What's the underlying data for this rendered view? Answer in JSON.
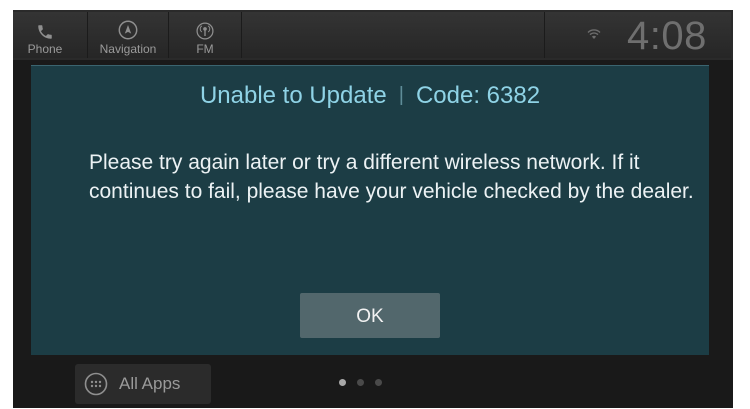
{
  "topbar": {
    "items": [
      {
        "label": "Phone",
        "icon": "phone-icon"
      },
      {
        "label": "Navigation",
        "icon": "compass-icon"
      },
      {
        "label": "FM",
        "icon": "radio-icon"
      }
    ],
    "status_icon": "wifi-icon",
    "clock": "4:08"
  },
  "dialog": {
    "title": "Unable to Update",
    "separator": "|",
    "code": "Code: 6382",
    "message": "Please try again later or try a different wireless network. If it continues to fail, please have your vehicle checked by the dealer.",
    "ok_label": "OK"
  },
  "bottombar": {
    "all_apps_label": "All Apps",
    "all_apps_icon": "apps-grid-icon",
    "page_count": 3,
    "active_page": 1
  },
  "colors": {
    "dialog_bg": "#1c3d45",
    "title": "#8fd3e6",
    "message": "#ecf2f4",
    "ok_button": "#52676c"
  }
}
